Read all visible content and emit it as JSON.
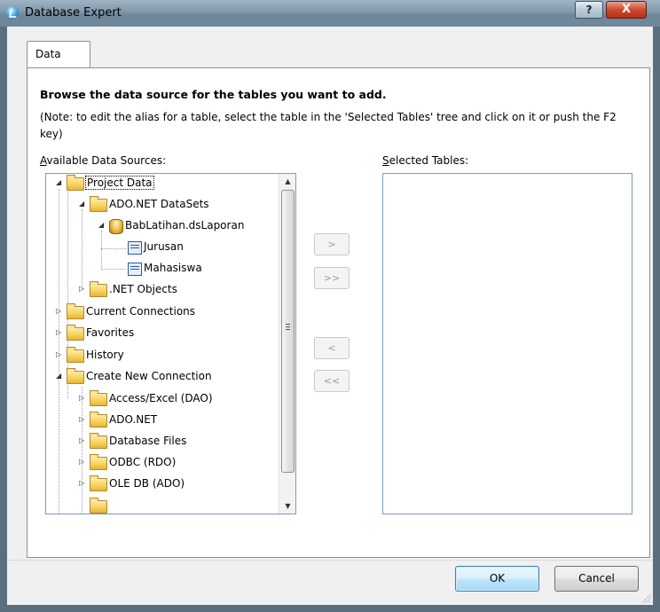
{
  "window": {
    "title": "Database Expert",
    "help_label": "?",
    "close_label": "X"
  },
  "tabs": [
    {
      "label": "Data",
      "selected": true
    }
  ],
  "panel": {
    "heading": "Browse the data source for the tables you want to add.",
    "note": "(Note: to edit the alias for a table, select the table in the 'Selected Tables' tree and click on it or push the F2 key)",
    "available_label_first": "A",
    "available_label_rest": "vailable Data Sources:",
    "selected_label_first": "S",
    "selected_label_rest": "elected Tables:"
  },
  "tree": {
    "nodes": [
      {
        "label": "Project Data",
        "icon": "folder-icon",
        "expanded": true,
        "selected": true
      },
      {
        "label": "ADO.NET DataSets",
        "icon": "folder-icon",
        "expanded": true
      },
      {
        "label": "BabLatihan.dsLaporan",
        "icon": "dataset-icon",
        "expanded": true
      },
      {
        "label": "Jurusan",
        "icon": "table-icon"
      },
      {
        "label": "Mahasiswa",
        "icon": "table-icon"
      },
      {
        "label": ".NET Objects",
        "icon": "folder-icon",
        "expanded": false
      },
      {
        "label": "Current Connections",
        "icon": "folder-icon",
        "expanded": false
      },
      {
        "label": "Favorites",
        "icon": "folder-icon",
        "expanded": false
      },
      {
        "label": "History",
        "icon": "folder-icon",
        "expanded": false
      },
      {
        "label": "Create New Connection",
        "icon": "folder-icon",
        "expanded": true
      },
      {
        "label": "Access/Excel (DAO)",
        "icon": "folder-icon",
        "expanded": false
      },
      {
        "label": "ADO.NET",
        "icon": "folder-icon",
        "expanded": false
      },
      {
        "label": "Database Files",
        "icon": "folder-icon",
        "expanded": false
      },
      {
        "label": "ODBC (RDO)",
        "icon": "folder-icon",
        "expanded": false
      },
      {
        "label": "OLE DB (ADO)",
        "icon": "folder-icon",
        "expanded": false
      }
    ]
  },
  "move_buttons": {
    "add": ">",
    "add_all": ">>",
    "remove": "<",
    "remove_all": "<<"
  },
  "footer": {
    "ok": "OK",
    "cancel": "Cancel"
  }
}
